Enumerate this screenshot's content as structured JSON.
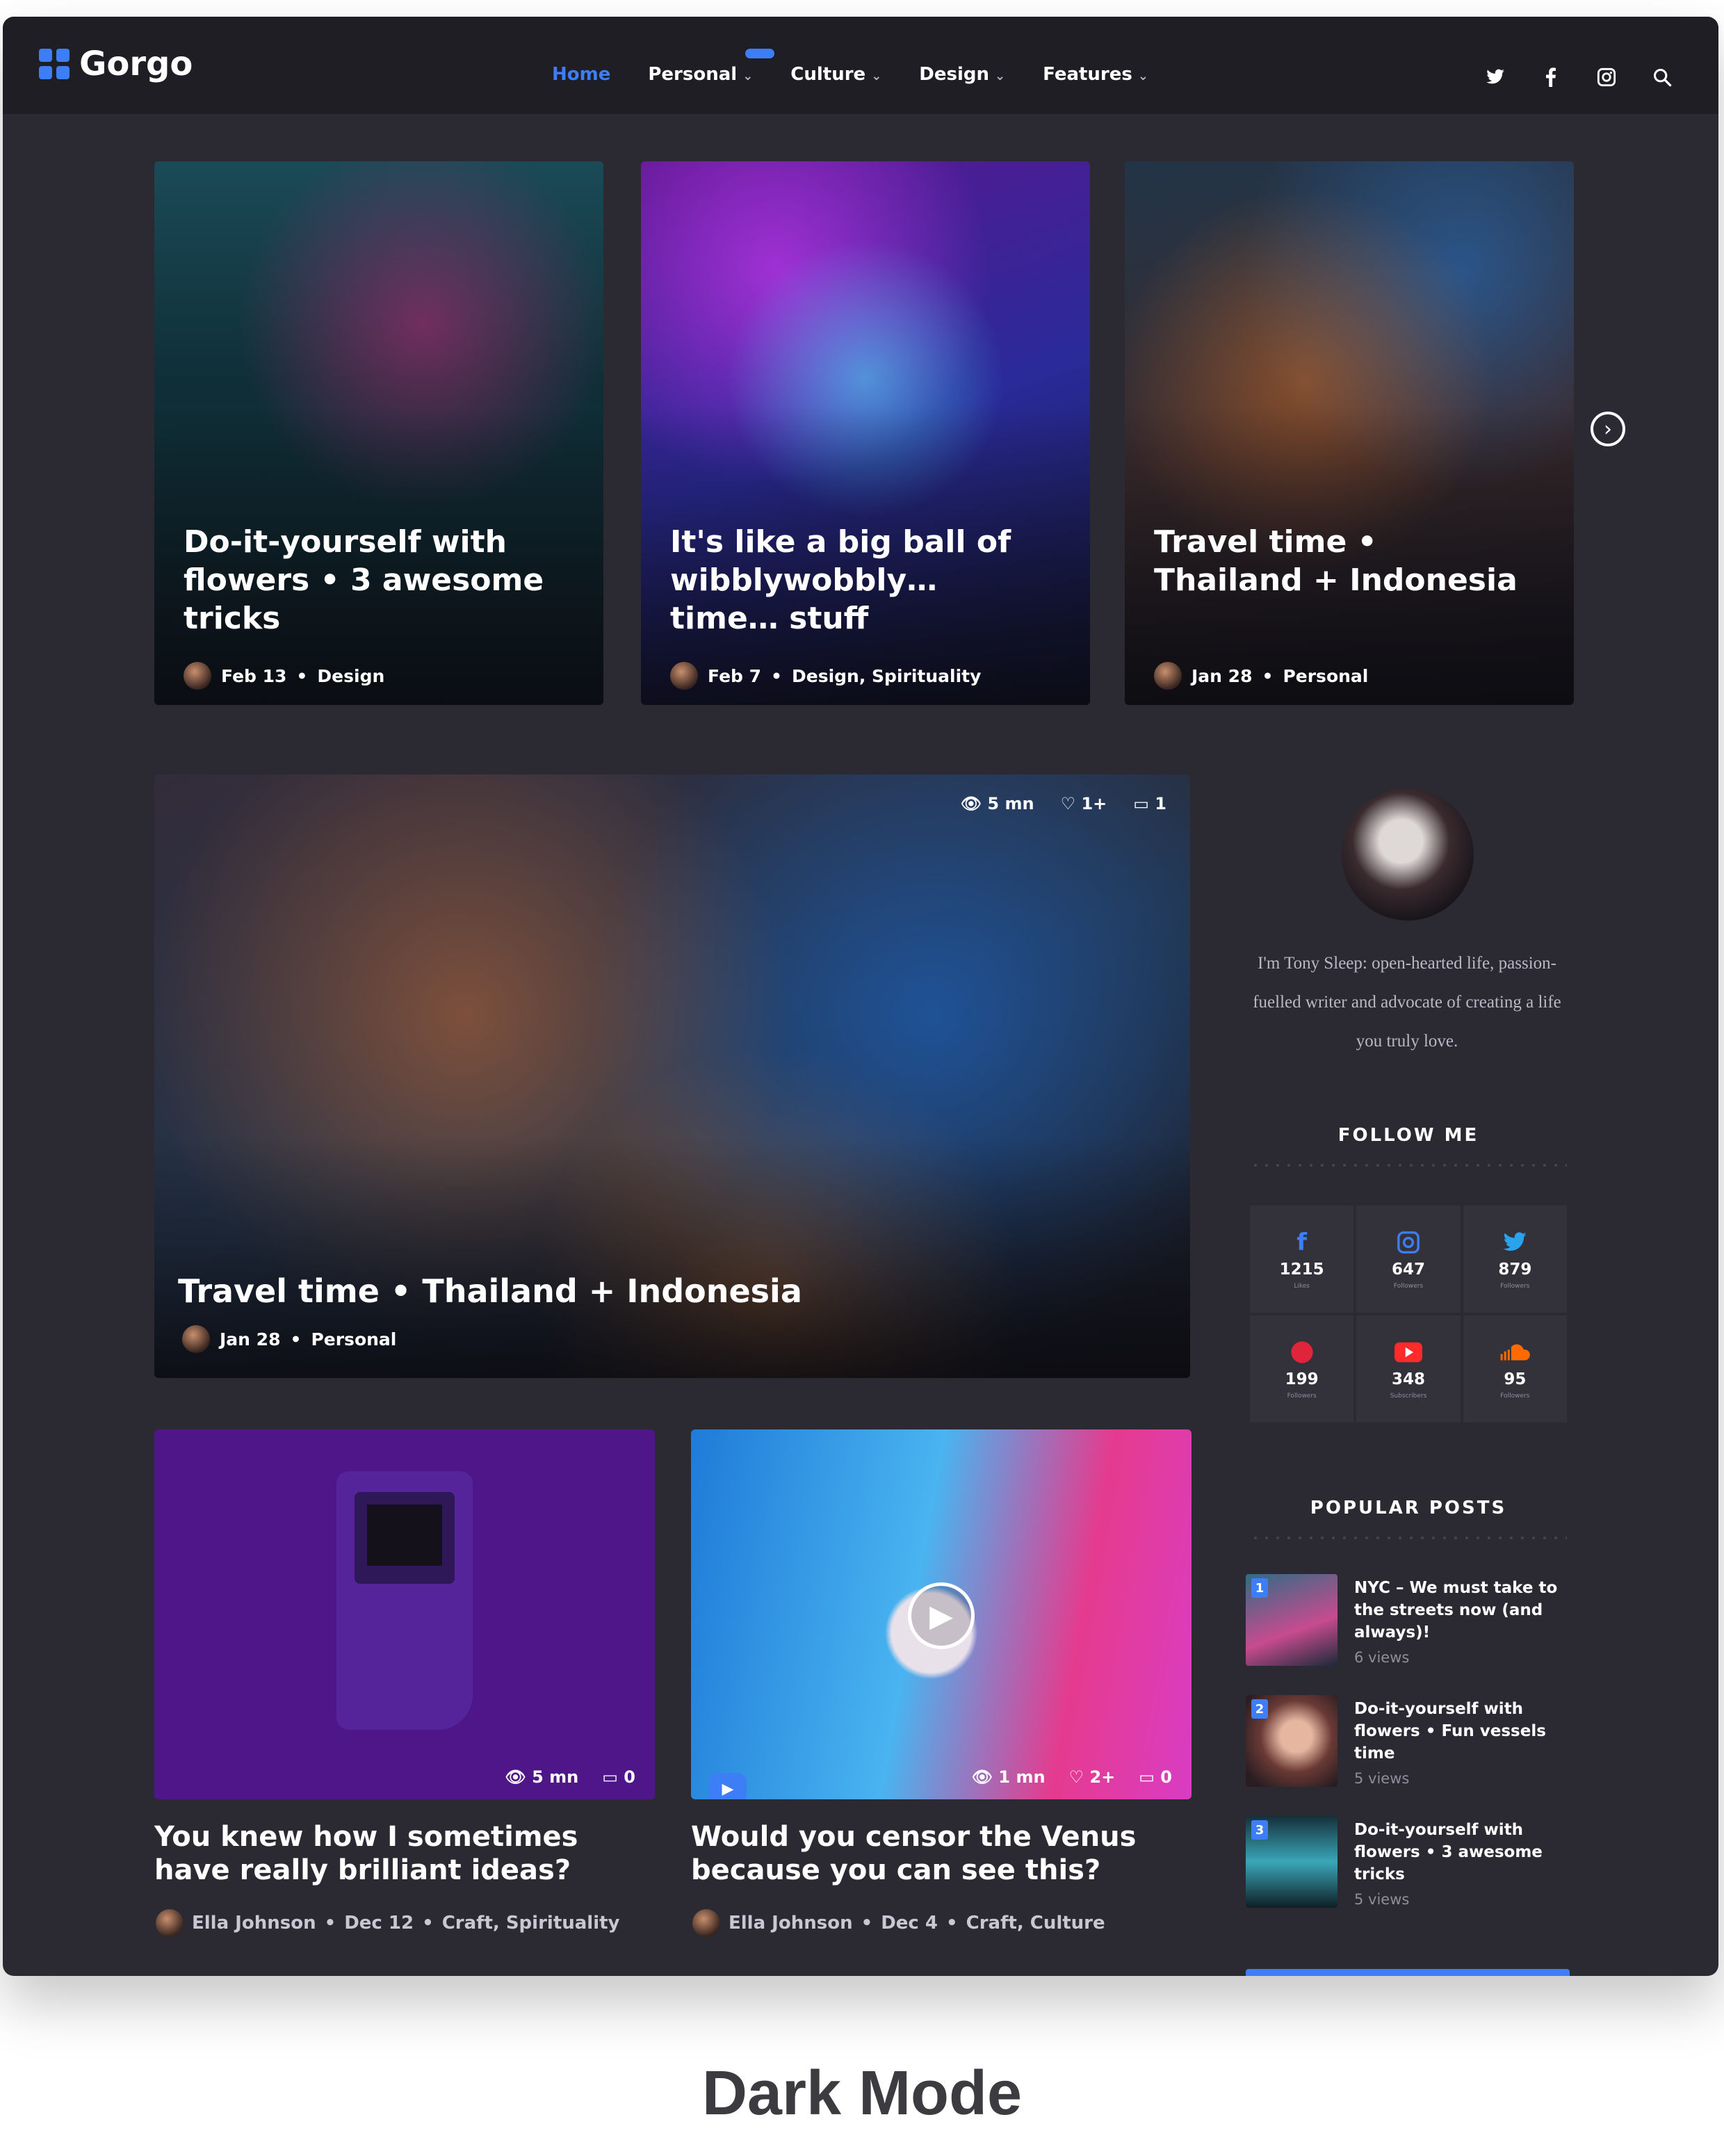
{
  "brand": {
    "name": "Gorgo",
    "accent": "#3d7df5"
  },
  "nav": {
    "items": [
      {
        "label": "Home",
        "dropdown": false,
        "active": true
      },
      {
        "label": "Personal",
        "dropdown": true,
        "active": false
      },
      {
        "label": "Culture",
        "dropdown": true,
        "active": false
      },
      {
        "label": "Design",
        "dropdown": true,
        "active": false
      },
      {
        "label": "Features",
        "dropdown": true,
        "active": false
      }
    ],
    "icons": [
      "twitter-icon",
      "facebook-icon",
      "instagram-icon",
      "search-icon"
    ]
  },
  "slider": [
    {
      "title": "Do-it-yourself with flowers • 3 awesome tricks",
      "date": "Feb 13",
      "category": "Design"
    },
    {
      "title": "It's like a big ball of wibblywobbly… time… stuff",
      "date": "Feb 7",
      "category": "Design, Spirituality"
    },
    {
      "title": "Travel time • Thailand + Indonesia",
      "date": "Jan 28",
      "category": "Personal"
    }
  ],
  "featured": {
    "title": "Travel time • Thailand + Indonesia",
    "date": "Jan 28",
    "category": "Personal",
    "stats": {
      "time": "5 mn",
      "likes": "1+",
      "comments": "1"
    }
  },
  "posts": [
    {
      "title": "You knew how I sometimes have really brilliant ideas?",
      "author": "Ella Johnson",
      "date": "Dec 12",
      "category": "Craft, Spirituality",
      "stats": {
        "time": "5 mn",
        "comments": "0"
      }
    },
    {
      "title": "Would you censor the Venus because you can see this?",
      "author": "Ella Johnson",
      "date": "Dec 4",
      "category": "Craft, Culture",
      "stats": {
        "time": "1 mn",
        "likes": "2+",
        "comments": "0"
      }
    }
  ],
  "sidebar": {
    "bio": "I'm Tony Sleep: open-hearted life, passion-fuelled writer and advocate of creating a life you truly love.",
    "follow_title": "FOLLOW ME",
    "follow": [
      {
        "icon": "facebook-icon",
        "glyph": "f",
        "color": "#3d7df5",
        "count": "1215",
        "label": "Likes"
      },
      {
        "icon": "instagram-icon",
        "glyph": "◎",
        "color": "#3d7df5",
        "count": "647",
        "label": "Followers"
      },
      {
        "icon": "twitter-icon",
        "glyph": "🐦",
        "color": "#2aa3ef",
        "count": "879",
        "label": "Followers"
      },
      {
        "icon": "pinterest-icon",
        "glyph": "●",
        "color": "#e0243a",
        "count": "199",
        "label": "Followers"
      },
      {
        "icon": "youtube-icon",
        "glyph": "▶",
        "color": "#ff2a2a",
        "count": "348",
        "label": "Subscribers"
      },
      {
        "icon": "soundcloud-icon",
        "glyph": "☁",
        "color": "#ff6a00",
        "count": "95",
        "label": "Followers"
      }
    ],
    "popular_title": "POPULAR POSTS",
    "popular": [
      {
        "num": "1",
        "title": "NYC – We must take to the streets now (and always)!",
        "views": "6 views"
      },
      {
        "num": "2",
        "title": "Do-it-yourself with flowers • Fun vessels time",
        "views": "5 views"
      },
      {
        "num": "3",
        "title": "Do-it-yourself with flowers • 3 awesome tricks",
        "views": "5 views"
      }
    ]
  },
  "caption": "Dark Mode"
}
